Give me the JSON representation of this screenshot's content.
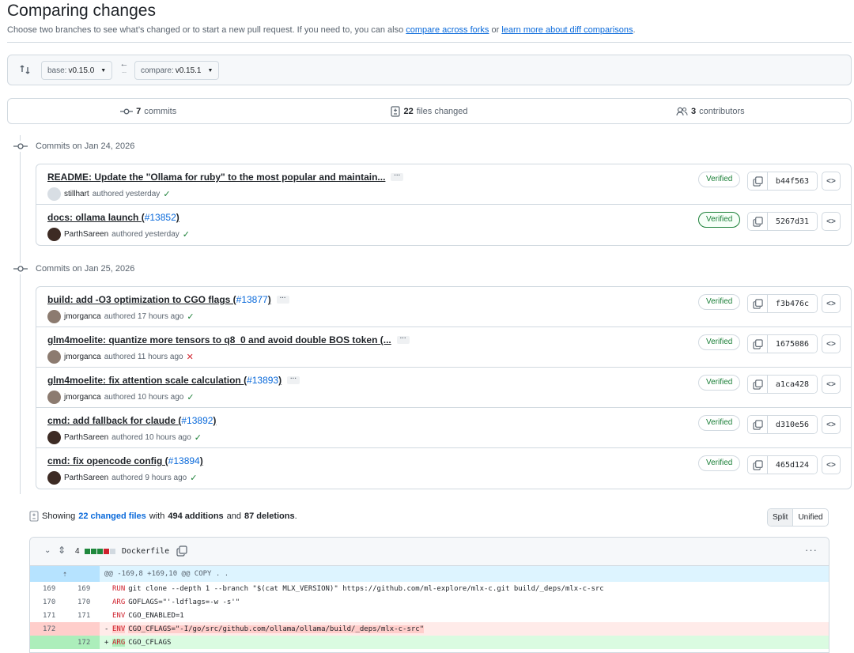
{
  "header": {
    "title": "Comparing changes",
    "subtitle_prefix": "Choose two branches to see what’s changed or to start a new pull request. If you need to, you can also",
    "link_forks": "compare across forks",
    "subtitle_or": "or",
    "link_learn": "learn more about diff comparisons",
    "subtitle_end": "."
  },
  "range": {
    "base_label": "base:",
    "base_value": "v0.15.0",
    "compare_label": "compare:",
    "compare_value": "v0.15.1",
    "swap_glyph": "←",
    "swap_dots": "..."
  },
  "stats": {
    "commits_count": "7",
    "commits_label": "commits",
    "files_count": "22",
    "files_label": "files changed",
    "contributors_count": "3",
    "contributors_label": "contributors"
  },
  "groups": [
    {
      "heading": "Commits on Jan 24, 2026",
      "commits": [
        {
          "title": "README: Update the \"Ollama for ruby\" to the most popular and maintain...",
          "pr": "",
          "has_more": true,
          "author": "stillhart",
          "when": "authored yesterday",
          "status": "ok",
          "verified": "Verified",
          "sha": "b44f563"
        },
        {
          "title": "docs: ollama launch (",
          "pr": "#13852",
          "has_more": false,
          "author": "ParthSareen",
          "when": "authored yesterday",
          "status": "ok",
          "verified": "Verified",
          "sha": "5267d31"
        }
      ]
    },
    {
      "heading": "Commits on Jan 25, 2026",
      "commits": [
        {
          "title": "build: add -O3 optimization to CGO flags (",
          "pr": "#13877",
          "has_more": true,
          "author": "jmorganca",
          "when": "authored 17 hours ago",
          "status": "ok",
          "verified": "Verified",
          "sha": "f3b476c"
        },
        {
          "title": "glm4moelite: quantize more tensors to q8_0 and avoid double BOS token (...",
          "pr": "",
          "has_more": true,
          "author": "jmorganca",
          "when": "authored 11 hours ago",
          "status": "fail",
          "verified": "Verified",
          "sha": "1675086"
        },
        {
          "title": "glm4moelite: fix attention scale calculation (",
          "pr": "#13893",
          "has_more": true,
          "author": "jmorganca",
          "when": "authored 10 hours ago",
          "status": "ok",
          "verified": "Verified",
          "sha": "a1ca428"
        },
        {
          "title": "cmd: add fallback for claude (",
          "pr": "#13892",
          "has_more": false,
          "author": "ParthSareen",
          "when": "authored 10 hours ago",
          "status": "ok",
          "verified": "Verified",
          "sha": "d310e56"
        },
        {
          "title": "cmd: fix opencode config (",
          "pr": "#13894",
          "has_more": false,
          "author": "ParthSareen",
          "when": "authored 9 hours ago",
          "status": "ok",
          "verified": "Verified",
          "sha": "465d124"
        }
      ]
    }
  ],
  "files_summary": {
    "showing": "Showing",
    "changed_files": "22 changed files",
    "with": "with",
    "additions": "494 additions",
    "and": "and",
    "deletions": "87 deletions",
    "end": "."
  },
  "view_toggle": {
    "split": "Split",
    "unified": "Unified"
  },
  "file": {
    "change_count": "4",
    "name": "Dockerfile",
    "more": "···",
    "hunk_header": "@@ -169,8 +169,10 @@ COPY . .",
    "lines": [
      {
        "type": "ctx",
        "old": "169",
        "new": "169",
        "kw": "RUN",
        "code": "git clone --depth 1 --branch \"$(cat MLX_VERSION)\" https://github.com/ml-explore/mlx-c.git build/_deps/mlx-c-src"
      },
      {
        "type": "ctx",
        "old": "170",
        "new": "170",
        "kw": "ARG",
        "code": "GOFLAGS=\"'-ldflags=-w -s'\""
      },
      {
        "type": "ctx",
        "old": "171",
        "new": "171",
        "kw": "ENV",
        "code": "CGO_ENABLED=1"
      },
      {
        "type": "del",
        "old": "172",
        "new": "",
        "sign": "-",
        "kw": "ENV",
        "code": "CGO_CFLAGS=\"-I/go/src/github.com/ollama/ollama/build/_deps/mlx-c-src\""
      },
      {
        "type": "add",
        "old": "",
        "new": "172",
        "sign": "+",
        "kw": "ARG",
        "code": "CGO_CFLAGS"
      }
    ]
  },
  "colors": {
    "accent": "#0969da",
    "success": "#1a7f37",
    "danger": "#d1242f"
  }
}
